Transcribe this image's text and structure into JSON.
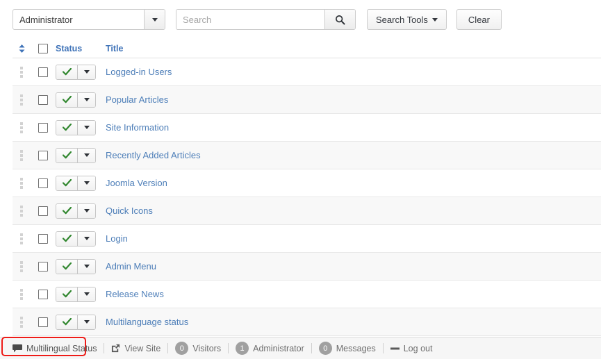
{
  "toolbar": {
    "filter_select": {
      "value": "Administrator",
      "caret_icon": "chevron-down-icon"
    },
    "search": {
      "placeholder": "Search",
      "value": "",
      "button_icon": "search-icon"
    },
    "search_tools_label": "Search Tools",
    "clear_label": "Clear"
  },
  "table": {
    "columns": {
      "sort_icon": "sort-updown-icon",
      "select_all": "",
      "status": "Status",
      "title": "Title"
    },
    "rows": [
      {
        "title": "Logged-in Users",
        "status_icon": "check-icon",
        "status": "Published"
      },
      {
        "title": "Popular Articles",
        "status_icon": "check-icon",
        "status": "Published"
      },
      {
        "title": "Site Information",
        "status_icon": "check-icon",
        "status": "Published"
      },
      {
        "title": "Recently Added Articles",
        "status_icon": "check-icon",
        "status": "Published"
      },
      {
        "title": "Joomla Version",
        "status_icon": "check-icon",
        "status": "Published"
      },
      {
        "title": "Quick Icons",
        "status_icon": "check-icon",
        "status": "Published"
      },
      {
        "title": "Login",
        "status_icon": "check-icon",
        "status": "Published"
      },
      {
        "title": "Admin Menu",
        "status_icon": "check-icon",
        "status": "Published"
      },
      {
        "title": "Release News",
        "status_icon": "check-icon",
        "status": "Published"
      },
      {
        "title": "Multilanguage status",
        "status_icon": "check-icon",
        "status": "Published"
      }
    ]
  },
  "footer": {
    "multilingual_status": {
      "label": "Multilingual Status",
      "icon": "speech-bubble-icon",
      "highlighted": true
    },
    "view_site": {
      "label": "View Site",
      "icon": "external-link-icon"
    },
    "visitors": {
      "count": "0",
      "label": "Visitors"
    },
    "administrator": {
      "count": "1",
      "label": "Administrator"
    },
    "messages": {
      "count": "0",
      "label": "Messages"
    },
    "logout": {
      "label": "Log out",
      "icon": "minus-icon"
    }
  },
  "colors": {
    "link_blue": "#4d7eb8",
    "header_blue": "#3f73b8",
    "status_green": "#31872f",
    "highlight_red": "#ee1c18",
    "badge_gray": "#a0a0a0"
  }
}
